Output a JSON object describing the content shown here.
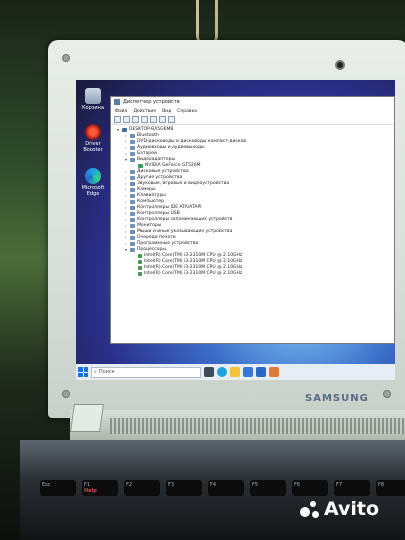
{
  "desktop": {
    "icons": [
      {
        "label": "Корзина",
        "name": "recycle-bin-icon"
      },
      {
        "label": "Driver Booster",
        "name": "driver-booster-icon"
      },
      {
        "label": "Microsoft Edge",
        "name": "edge-icon"
      }
    ]
  },
  "window": {
    "title": "Диспетчер устройств",
    "menu": [
      "Файл",
      "Действие",
      "Вид",
      "Справка"
    ],
    "tree": [
      {
        "label": "DESKTOP-BA5G6MB",
        "level": 0,
        "kind": "root",
        "expanded": true
      },
      {
        "label": "Bluetooth",
        "level": 1
      },
      {
        "label": "DVD-дисководы и дисководы компакт-дисков",
        "level": 1
      },
      {
        "label": "Аудиовходы и аудиовыходы",
        "level": 1
      },
      {
        "label": "Батареи",
        "level": 1
      },
      {
        "label": "Видеоадаптеры",
        "level": 1,
        "expanded": true
      },
      {
        "label": "NVIDIA GeForce GT520M",
        "level": 2,
        "kind": "gpu"
      },
      {
        "label": "Дисковые устройства",
        "level": 1
      },
      {
        "label": "Другие устройства",
        "level": 1
      },
      {
        "label": "Звуковые, игровые и видеоустройства",
        "level": 1
      },
      {
        "label": "Камеры",
        "level": 1
      },
      {
        "label": "Клавиатуры",
        "level": 1
      },
      {
        "label": "Компьютер",
        "level": 1
      },
      {
        "label": "Контроллеры IDE ATA/ATAPI",
        "level": 1
      },
      {
        "label": "Контроллеры USB",
        "level": 1
      },
      {
        "label": "Контроллеры запоминающих устройств",
        "level": 1
      },
      {
        "label": "Мониторы",
        "level": 1
      },
      {
        "label": "Мыши и иные указывающие устройства",
        "level": 1
      },
      {
        "label": "Очереди печати",
        "level": 1
      },
      {
        "label": "Программные устройства",
        "level": 1
      },
      {
        "label": "Процессоры",
        "level": 1,
        "expanded": true
      },
      {
        "label": "Intel(R) Core(TM) i3-2310M CPU @ 2.10GHz",
        "level": 2,
        "kind": "cpu"
      },
      {
        "label": "Intel(R) Core(TM) i3-2310M CPU @ 2.10GHz",
        "level": 2,
        "kind": "cpu"
      },
      {
        "label": "Intel(R) Core(TM) i3-2310M CPU @ 2.10GHz",
        "level": 2,
        "kind": "cpu"
      },
      {
        "label": "Intel(R) Core(TM) i3-2310M CPU @ 2.10GHz",
        "level": 2,
        "kind": "cpu"
      }
    ]
  },
  "taskbar": {
    "search_placeholder": "Поиск",
    "pinned": [
      "task-view-icon",
      "edge-icon",
      "explorer-icon",
      "store-icon",
      "mail-icon",
      "photos-icon"
    ]
  },
  "device": {
    "brand": "SAMSUNG"
  },
  "keyboard": {
    "keys": [
      {
        "label": "Esc",
        "sub": ""
      },
      {
        "label": "F1",
        "sub": "Help"
      },
      {
        "label": "F2",
        "sub": ""
      },
      {
        "label": "F3",
        "sub": ""
      },
      {
        "label": "F4",
        "sub": ""
      },
      {
        "label": "F5",
        "sub": ""
      },
      {
        "label": "F6",
        "sub": ""
      },
      {
        "label": "F7",
        "sub": ""
      },
      {
        "label": "F8",
        "sub": ""
      }
    ]
  },
  "watermark": {
    "text": "Avito"
  },
  "colors": {
    "accent": "#1a73d9",
    "window_bg": "#ffffff",
    "taskbar_bg": "#e6edf5"
  }
}
